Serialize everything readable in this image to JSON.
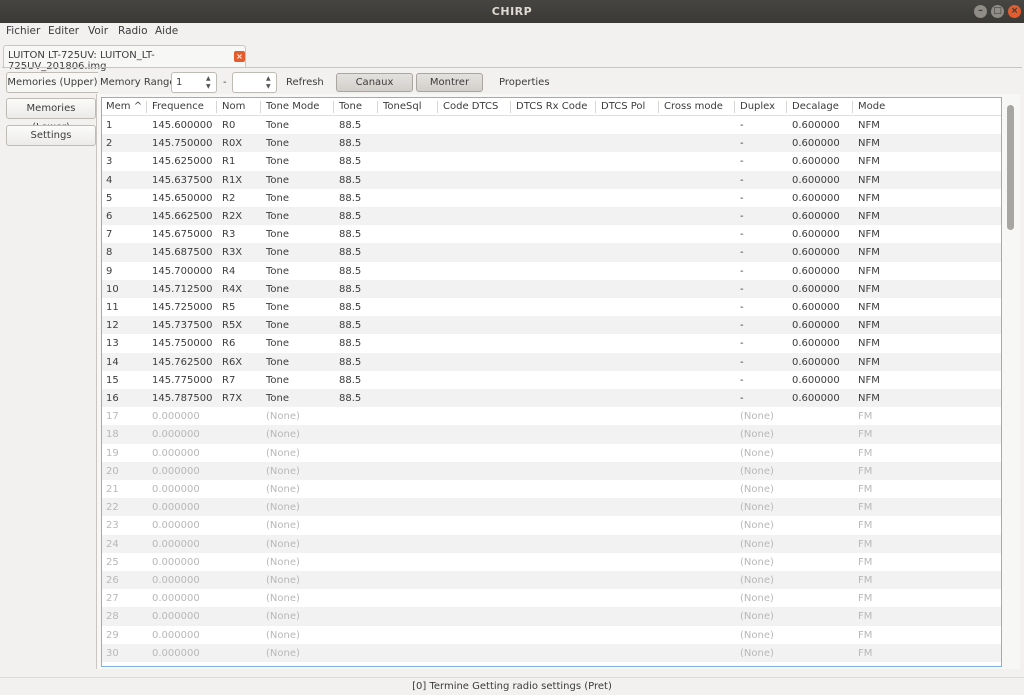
{
  "window": {
    "title": "CHIRP",
    "min_glyph": "–",
    "max_glyph": "□",
    "close_glyph": "×"
  },
  "menu": [
    "Fichier",
    "Editer",
    "Voir",
    "Radio",
    "Aide"
  ],
  "file_tab": {
    "label": "LUITON LT-725UV: LUITON_LT-725UV_201806.img",
    "close_glyph": "×"
  },
  "side_tabs": [
    "Memories (Upper)",
    "Memories (Lower)",
    "Settings"
  ],
  "toolbar": {
    "memory_range_label": "Memory Range:",
    "range_start": "1",
    "range_dash": "-",
    "range_end": "",
    "refresh_label": "Refresh",
    "special_channels_label": "Canaux speciaux",
    "show_empty_label": "Montrer vides",
    "properties_label": "Properties",
    "spin_arrows": "▲▼"
  },
  "table": {
    "columns": [
      "Mem",
      "Frequence",
      "Nom",
      "Tone Mode",
      "Tone",
      "ToneSql",
      "Code DTCS",
      "DTCS Rx Code",
      "DTCS Pol",
      "Cross mode",
      "Duplex",
      "Decalage",
      "Mode"
    ],
    "sort_indicator": "^",
    "rows": [
      [
        "1",
        "145.600000",
        "R0",
        "Tone",
        "88.5",
        "",
        "",
        "",
        "",
        "",
        "-",
        "0.600000",
        "NFM"
      ],
      [
        "2",
        "145.750000",
        "R0X",
        "Tone",
        "88.5",
        "",
        "",
        "",
        "",
        "",
        "-",
        "0.600000",
        "NFM"
      ],
      [
        "3",
        "145.625000",
        "R1",
        "Tone",
        "88.5",
        "",
        "",
        "",
        "",
        "",
        "-",
        "0.600000",
        "NFM"
      ],
      [
        "4",
        "145.637500",
        "R1X",
        "Tone",
        "88.5",
        "",
        "",
        "",
        "",
        "",
        "-",
        "0.600000",
        "NFM"
      ],
      [
        "5",
        "145.650000",
        "R2",
        "Tone",
        "88.5",
        "",
        "",
        "",
        "",
        "",
        "-",
        "0.600000",
        "NFM"
      ],
      [
        "6",
        "145.662500",
        "R2X",
        "Tone",
        "88.5",
        "",
        "",
        "",
        "",
        "",
        "-",
        "0.600000",
        "NFM"
      ],
      [
        "7",
        "145.675000",
        "R3",
        "Tone",
        "88.5",
        "",
        "",
        "",
        "",
        "",
        "-",
        "0.600000",
        "NFM"
      ],
      [
        "8",
        "145.687500",
        "R3X",
        "Tone",
        "88.5",
        "",
        "",
        "",
        "",
        "",
        "-",
        "0.600000",
        "NFM"
      ],
      [
        "9",
        "145.700000",
        "R4",
        "Tone",
        "88.5",
        "",
        "",
        "",
        "",
        "",
        "-",
        "0.600000",
        "NFM"
      ],
      [
        "10",
        "145.712500",
        "R4X",
        "Tone",
        "88.5",
        "",
        "",
        "",
        "",
        "",
        "-",
        "0.600000",
        "NFM"
      ],
      [
        "11",
        "145.725000",
        "R5",
        "Tone",
        "88.5",
        "",
        "",
        "",
        "",
        "",
        "-",
        "0.600000",
        "NFM"
      ],
      [
        "12",
        "145.737500",
        "R5X",
        "Tone",
        "88.5",
        "",
        "",
        "",
        "",
        "",
        "-",
        "0.600000",
        "NFM"
      ],
      [
        "13",
        "145.750000",
        "R6",
        "Tone",
        "88.5",
        "",
        "",
        "",
        "",
        "",
        "-",
        "0.600000",
        "NFM"
      ],
      [
        "14",
        "145.762500",
        "R6X",
        "Tone",
        "88.5",
        "",
        "",
        "",
        "",
        "",
        "-",
        "0.600000",
        "NFM"
      ],
      [
        "15",
        "145.775000",
        "R7",
        "Tone",
        "88.5",
        "",
        "",
        "",
        "",
        "",
        "-",
        "0.600000",
        "NFM"
      ],
      [
        "16",
        "145.787500",
        "R7X",
        "Tone",
        "88.5",
        "",
        "",
        "",
        "",
        "",
        "-",
        "0.600000",
        "NFM"
      ],
      [
        "17",
        "0.000000",
        "",
        "(None)",
        "",
        "",
        "",
        "",
        "",
        "",
        "(None)",
        "",
        "FM"
      ],
      [
        "18",
        "0.000000",
        "",
        "(None)",
        "",
        "",
        "",
        "",
        "",
        "",
        "(None)",
        "",
        "FM"
      ],
      [
        "19",
        "0.000000",
        "",
        "(None)",
        "",
        "",
        "",
        "",
        "",
        "",
        "(None)",
        "",
        "FM"
      ],
      [
        "20",
        "0.000000",
        "",
        "(None)",
        "",
        "",
        "",
        "",
        "",
        "",
        "(None)",
        "",
        "FM"
      ],
      [
        "21",
        "0.000000",
        "",
        "(None)",
        "",
        "",
        "",
        "",
        "",
        "",
        "(None)",
        "",
        "FM"
      ],
      [
        "22",
        "0.000000",
        "",
        "(None)",
        "",
        "",
        "",
        "",
        "",
        "",
        "(None)",
        "",
        "FM"
      ],
      [
        "23",
        "0.000000",
        "",
        "(None)",
        "",
        "",
        "",
        "",
        "",
        "",
        "(None)",
        "",
        "FM"
      ],
      [
        "24",
        "0.000000",
        "",
        "(None)",
        "",
        "",
        "",
        "",
        "",
        "",
        "(None)",
        "",
        "FM"
      ],
      [
        "25",
        "0.000000",
        "",
        "(None)",
        "",
        "",
        "",
        "",
        "",
        "",
        "(None)",
        "",
        "FM"
      ],
      [
        "26",
        "0.000000",
        "",
        "(None)",
        "",
        "",
        "",
        "",
        "",
        "",
        "(None)",
        "",
        "FM"
      ],
      [
        "27",
        "0.000000",
        "",
        "(None)",
        "",
        "",
        "",
        "",
        "",
        "",
        "(None)",
        "",
        "FM"
      ],
      [
        "28",
        "0.000000",
        "",
        "(None)",
        "",
        "",
        "",
        "",
        "",
        "",
        "(None)",
        "",
        "FM"
      ],
      [
        "29",
        "0.000000",
        "",
        "(None)",
        "",
        "",
        "",
        "",
        "",
        "",
        "(None)",
        "",
        "FM"
      ],
      [
        "30",
        "0.000000",
        "",
        "(None)",
        "",
        "",
        "",
        "",
        "",
        "",
        "(None)",
        "",
        "FM"
      ]
    ]
  },
  "status": {
    "text": "[0] Termine Getting radio settings (Pret)"
  },
  "colors": {
    "selection_border": "#7fb2e5",
    "close_accent": "#e25c2e",
    "titlebar": "#3a3936"
  }
}
